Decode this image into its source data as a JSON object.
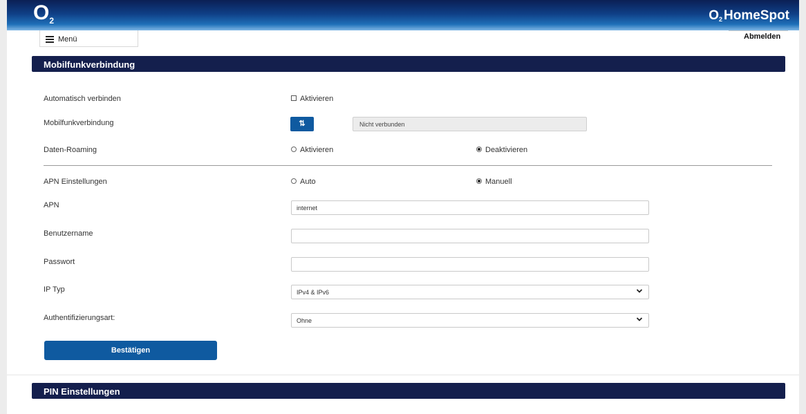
{
  "header": {
    "logo_main": "O",
    "logo_sub": "2",
    "brand_sub": "2",
    "brand_main": "O",
    "brand_text": "HomeSpot"
  },
  "nav": {
    "menu_label": "Menü",
    "logout_label": "Abmelden"
  },
  "section_mobile": {
    "title": "Mobilfunkverbindung",
    "auto_connect": {
      "label": "Automatisch verbinden",
      "checkbox_label": "Aktivieren",
      "checked": false
    },
    "connection": {
      "label": "Mobilfunkverbindung",
      "button_icon": "⇅",
      "status": "Nicht verbunden"
    },
    "roaming": {
      "label": "Daten-Roaming",
      "options": [
        "Aktivieren",
        "Deaktivieren"
      ],
      "selected": "Deaktivieren"
    },
    "apn_settings": {
      "label": "APN Einstellungen",
      "options": [
        "Auto",
        "Manuell"
      ],
      "selected": "Manuell"
    },
    "apn": {
      "label": "APN",
      "value": "internet"
    },
    "username": {
      "label": "Benutzername",
      "value": ""
    },
    "password": {
      "label": "Passwort",
      "value": ""
    },
    "ip_type": {
      "label": "IP Typ",
      "selected": "IPv4 & IPv6"
    },
    "auth_type": {
      "label": "Authentifizierungsart:",
      "selected": "Ohne"
    },
    "submit_label": "Bestätigen"
  },
  "section_pin": {
    "title": "PIN Einstellungen"
  },
  "colors": {
    "section_bar": "#141f4d",
    "button": "#0f5aa0",
    "header_top": "#0b1f55",
    "header_bottom": "#7fb6e4"
  },
  "icons": {
    "menu": "hamburger-icon",
    "connect": "swap-arrows-icon",
    "dropdown": "chevron-down-icon"
  }
}
